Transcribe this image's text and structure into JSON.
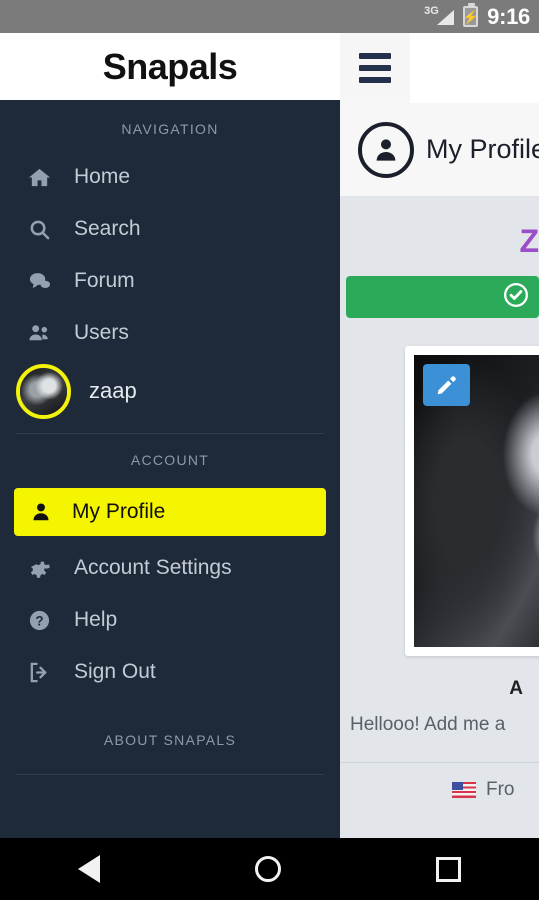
{
  "statusbar": {
    "network": "3G",
    "time": "9:16",
    "signal_icon": "signal-bars-icon",
    "battery_icon": "battery-charging-icon"
  },
  "appbar": {
    "brand": "Snapals",
    "menu_icon": "hamburger-menu-icon"
  },
  "sidebar": {
    "navigation_label": "NAVIGATION",
    "nav_items": [
      {
        "label": "Home",
        "icon": "home-icon"
      },
      {
        "label": "Search",
        "icon": "search-icon"
      },
      {
        "label": "Forum",
        "icon": "chat-bubbles-icon"
      },
      {
        "label": "Users",
        "icon": "users-icon"
      }
    ],
    "user": {
      "name": "zaap",
      "avatar_icon": "user-avatar"
    },
    "account_label": "ACCOUNT",
    "account_items": [
      {
        "label": "My Profile",
        "icon": "person-icon",
        "active": true
      },
      {
        "label": "Account Settings",
        "icon": "gear-icon",
        "active": false
      },
      {
        "label": "Help",
        "icon": "question-mark-icon",
        "active": false
      },
      {
        "label": "Sign Out",
        "icon": "sign-out-icon",
        "active": false
      }
    ],
    "about_label": "ABOUT SNAPALS",
    "colors": {
      "background": "#1e2a3a",
      "active_item": "#f5f500",
      "avatar_ring": "#f2f20a"
    }
  },
  "content": {
    "header": {
      "title": "My Profile",
      "icon": "person-circle-icon"
    },
    "profile_title": "Z",
    "alert": {
      "icon": "check-circle-icon",
      "color": "#2bab5a"
    },
    "photo": {
      "edit_icon": "pencil-edit-icon",
      "edit_color": "#3c91d6"
    },
    "section_heading": "A",
    "bio": "Hellooo! Add me a",
    "from": {
      "flag_icon": "us-flag-icon",
      "text": "Fro"
    },
    "colors": {
      "background": "#e2e6ea",
      "title": "#9b4dca"
    }
  },
  "navbar": {
    "back": "back-icon",
    "home": "home-circle-icon",
    "recents": "recents-square-icon"
  }
}
